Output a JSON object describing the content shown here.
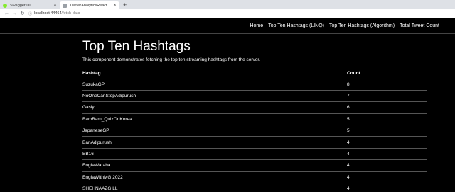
{
  "browser": {
    "tabs": [
      {
        "title": "Swagger UI",
        "active": false,
        "favicon_color": "#85ea2d"
      },
      {
        "title": "TwitterAnalyticsReact",
        "active": true,
        "favicon_color": "#9aa0a6"
      }
    ],
    "new_tab_label": "+",
    "url_host": "localhost:44464",
    "url_path": "/fetch-data"
  },
  "nav": {
    "items": [
      "Home",
      "Top Ten Hashtags (LINQ)",
      "Top Ten Hashtags (Algorithm)",
      "Total Tweet Count"
    ]
  },
  "main": {
    "title": "Top Ten Hashtags",
    "description": "This component demonstrates fetching the top ten streaming hashtags from the server.",
    "table": {
      "headers": [
        "Hashtag",
        "Count"
      ],
      "rows": [
        [
          "SuzukaGP",
          "8"
        ],
        [
          "NoOneCanStopAdipurush",
          "7"
        ],
        [
          "Gasly",
          "6"
        ],
        [
          "BamBam_QuizOnKorea",
          "5"
        ],
        [
          "JapaneseGP",
          "5"
        ],
        [
          "BanAdipurush",
          "4"
        ],
        [
          "BB16",
          "4"
        ],
        [
          "EngfaWaraha",
          "4"
        ],
        [
          "EngfaWithMGI2022",
          "4"
        ],
        [
          "SHEHNAAZGILL",
          "4"
        ]
      ]
    }
  }
}
